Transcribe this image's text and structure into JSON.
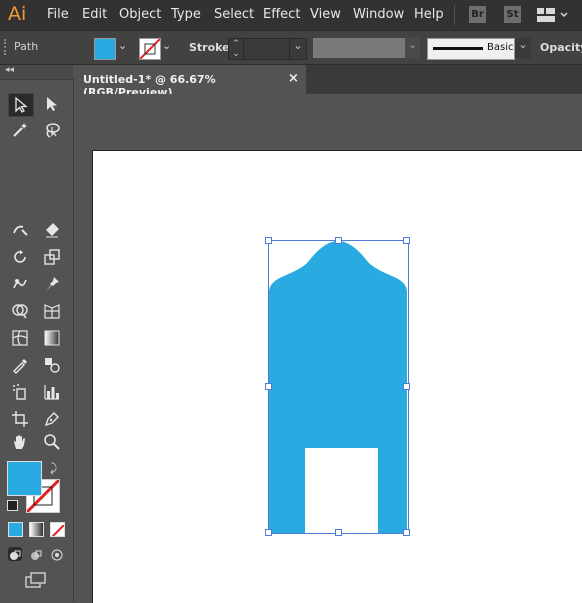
{
  "app": {
    "logo_text": "Ai",
    "menu": [
      "File",
      "Edit",
      "Object",
      "Type",
      "Select",
      "Effect",
      "View",
      "Window",
      "Help"
    ],
    "bridge_label": "Br",
    "stock_label": "St"
  },
  "control_bar": {
    "selection_type": "Path",
    "fill_color": "#29abe2",
    "stroke_label": "Stroke:",
    "brush_label": "Basic",
    "opacity_label": "Opacity:"
  },
  "document": {
    "tab_title": "Untitled-1* @ 66.67% (RGB/Preview)",
    "close_glyph": "×"
  },
  "tools_panel": {
    "collapse_glyph": "◂◂",
    "fill_swatch_color": "#29abe2",
    "stroke_swatch": "none"
  },
  "colors": {
    "accent": "#29abe2",
    "selection": "#4f7ad8",
    "ui_dark": "#323232",
    "ui_mid": "#535353"
  }
}
